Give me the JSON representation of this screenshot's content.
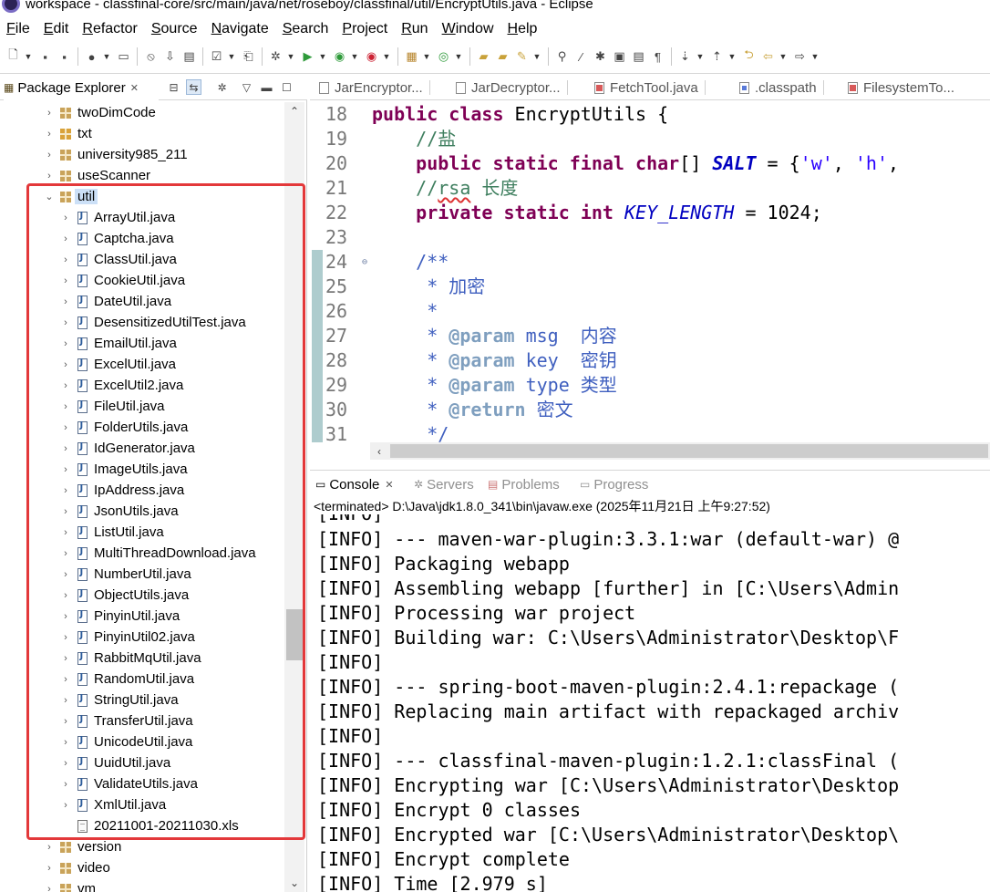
{
  "window": {
    "title": "workspace - classfinal-core/src/main/java/net/roseboy/classfinal/util/EncryptUtils.java - Eclipse"
  },
  "menu": [
    "File",
    "Edit",
    "Refactor",
    "Source",
    "Navigate",
    "Search",
    "Project",
    "Run",
    "Window",
    "Help"
  ],
  "explorer": {
    "tab_label": "Package Explorer",
    "tree": [
      {
        "label": "twoDimCode",
        "kind": "package",
        "indent": 0,
        "expanded": false
      },
      {
        "label": "txt",
        "kind": "package-special",
        "indent": 0,
        "expanded": false
      },
      {
        "label": "university985_211",
        "kind": "package",
        "indent": 0,
        "expanded": false
      },
      {
        "label": "useScanner",
        "kind": "package",
        "indent": 0,
        "expanded": false
      },
      {
        "label": "util",
        "kind": "package",
        "indent": 0,
        "expanded": true,
        "selected": true
      },
      {
        "label": "ArrayUtil.java",
        "kind": "java",
        "indent": 1,
        "expanded": false
      },
      {
        "label": "Captcha.java",
        "kind": "java",
        "indent": 1,
        "expanded": false
      },
      {
        "label": "ClassUtil.java",
        "kind": "java",
        "indent": 1,
        "expanded": false
      },
      {
        "label": "CookieUtil.java",
        "kind": "java",
        "indent": 1,
        "expanded": false
      },
      {
        "label": "DateUtil.java",
        "kind": "java",
        "indent": 1,
        "expanded": false
      },
      {
        "label": "DesensitizedUtilTest.java",
        "kind": "java",
        "indent": 1,
        "expanded": false
      },
      {
        "label": "EmailUtil.java",
        "kind": "java",
        "indent": 1,
        "expanded": false
      },
      {
        "label": "ExcelUtil.java",
        "kind": "java",
        "indent": 1,
        "expanded": false
      },
      {
        "label": "ExcelUtil2.java",
        "kind": "java",
        "indent": 1,
        "expanded": false
      },
      {
        "label": "FileUtil.java",
        "kind": "java",
        "indent": 1,
        "expanded": false
      },
      {
        "label": "FolderUtils.java",
        "kind": "java",
        "indent": 1,
        "expanded": false
      },
      {
        "label": "IdGenerator.java",
        "kind": "java",
        "indent": 1,
        "expanded": false
      },
      {
        "label": "ImageUtils.java",
        "kind": "java",
        "indent": 1,
        "expanded": false
      },
      {
        "label": "IpAddress.java",
        "kind": "java",
        "indent": 1,
        "expanded": false
      },
      {
        "label": "JsonUtils.java",
        "kind": "java",
        "indent": 1,
        "expanded": false
      },
      {
        "label": "ListUtil.java",
        "kind": "java",
        "indent": 1,
        "expanded": false
      },
      {
        "label": "MultiThreadDownload.java",
        "kind": "java",
        "indent": 1,
        "expanded": false
      },
      {
        "label": "NumberUtil.java",
        "kind": "java",
        "indent": 1,
        "expanded": false
      },
      {
        "label": "ObjectUtils.java",
        "kind": "java",
        "indent": 1,
        "expanded": false
      },
      {
        "label": "PinyinUtil.java",
        "kind": "java",
        "indent": 1,
        "expanded": false
      },
      {
        "label": "PinyinUtil02.java",
        "kind": "java",
        "indent": 1,
        "expanded": false
      },
      {
        "label": "RabbitMqUtil.java",
        "kind": "java",
        "indent": 1,
        "expanded": false
      },
      {
        "label": "RandomUtil.java",
        "kind": "java",
        "indent": 1,
        "expanded": false
      },
      {
        "label": "StringUtil.java",
        "kind": "java",
        "indent": 1,
        "expanded": false
      },
      {
        "label": "TransferUtil.java",
        "kind": "java",
        "indent": 1,
        "expanded": false
      },
      {
        "label": "UnicodeUtil.java",
        "kind": "java",
        "indent": 1,
        "expanded": false
      },
      {
        "label": "UuidUtil.java",
        "kind": "java",
        "indent": 1,
        "expanded": false
      },
      {
        "label": "ValidateUtils.java",
        "kind": "java",
        "indent": 1,
        "expanded": false
      },
      {
        "label": "XmlUtil.java",
        "kind": "java",
        "indent": 1,
        "expanded": false
      },
      {
        "label": "20211001-20211030.xls",
        "kind": "file",
        "indent": 1,
        "expanded": null
      },
      {
        "label": "version",
        "kind": "package",
        "indent": 0,
        "expanded": false
      },
      {
        "label": "video",
        "kind": "package",
        "indent": 0,
        "expanded": false
      },
      {
        "label": "vm",
        "kind": "package",
        "indent": 0,
        "expanded": false
      }
    ]
  },
  "editor": {
    "tabs": [
      {
        "label": "JarEncryptor...",
        "icon": "java-file-icon"
      },
      {
        "label": "JarDecryptor...",
        "icon": "java-file-icon"
      },
      {
        "label": "FetchTool.java",
        "icon": "java-file-icon"
      },
      {
        "label": ".classpath",
        "icon": "xml-file-icon"
      },
      {
        "label": "FilesystemTo...",
        "icon": "java-file-icon"
      }
    ],
    "lines": [
      {
        "num": "18",
        "text": "public class EncryptUtils {"
      },
      {
        "num": "19",
        "text": "    //盐"
      },
      {
        "num": "20",
        "text": "    public static final char[] SALT = {'w', 'h',"
      },
      {
        "num": "21",
        "text": "    //rsa 长度"
      },
      {
        "num": "22",
        "text": "    private static int KEY_LENGTH = 1024;"
      },
      {
        "num": "23",
        "text": ""
      },
      {
        "num": "24",
        "text": "    /**"
      },
      {
        "num": "25",
        "text": "     * 加密"
      },
      {
        "num": "26",
        "text": "     *"
      },
      {
        "num": "27",
        "text": "     * @param msg  内容"
      },
      {
        "num": "28",
        "text": "     * @param key  密钥"
      },
      {
        "num": "29",
        "text": "     * @param type 类型"
      },
      {
        "num": "30",
        "text": "     * @return 密文"
      },
      {
        "num": "31",
        "text": "     */"
      }
    ]
  },
  "console": {
    "tabs": [
      {
        "label": "Console",
        "active": true
      },
      {
        "label": "Servers",
        "active": false
      },
      {
        "label": "Problems",
        "active": false
      },
      {
        "label": "Progress",
        "active": false
      }
    ],
    "status": "<terminated> D:\\Java\\jdk1.8.0_341\\bin\\javaw.exe (2025年11月21日 上午9:27:52)",
    "lines": [
      "[INFO] --- maven-war-plugin:3.3.1:war (default-war) @",
      "[INFO] Packaging webapp",
      "[INFO] Assembling webapp [further] in [C:\\Users\\Admin",
      "[INFO] Processing war project",
      "[INFO] Building war: C:\\Users\\Administrator\\Desktop\\F",
      "[INFO]",
      "[INFO] --- spring-boot-maven-plugin:2.4.1:repackage (",
      "[INFO] Replacing main artifact with repackaged archiv",
      "[INFO]",
      "[INFO] --- classfinal-maven-plugin:1.2.1:classFinal (",
      "[INFO] Encrypting war [C:\\Users\\Administrator\\Desktop",
      "[INFO] Encrypt 0 classes",
      "[INFO] Encrypted war [C:\\Users\\Administrator\\Desktop\\",
      "[INFO] Encrypt complete",
      "[INFO] Time [2.979 s]"
    ]
  },
  "colors": {
    "keyword": "#7f0055",
    "javadoc": "#3f5fbf",
    "comment": "#3f7f5f",
    "constant": "#0000c0",
    "string": "#2a00ff",
    "highlight_box": "#e3383a"
  }
}
